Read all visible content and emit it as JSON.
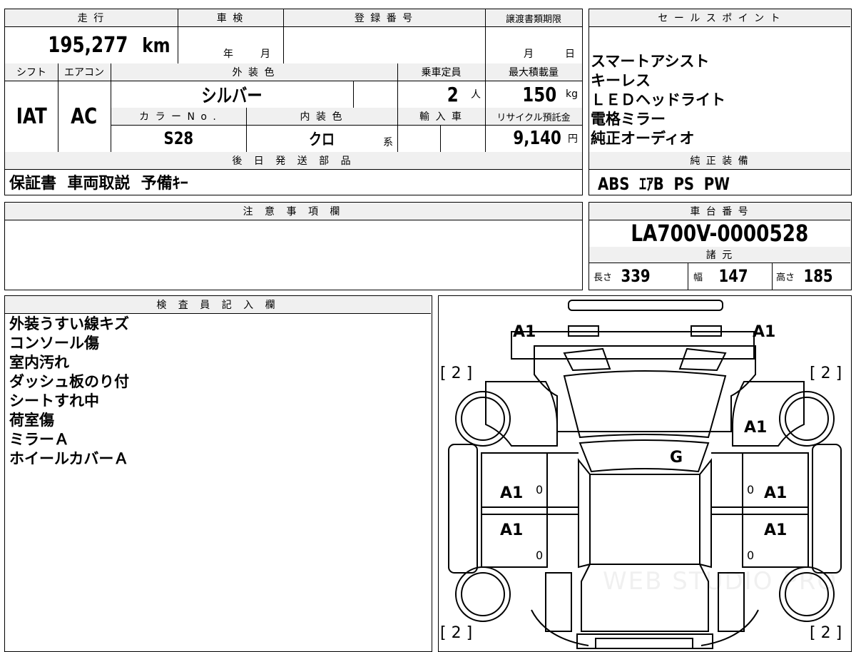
{
  "spec": {
    "mileage_header": "走 行",
    "inspection_header": "車 検",
    "registration_header": "登 録 番 号",
    "transfer_deadline_header": "譲渡書類期限",
    "mileage_value": "195,277",
    "mileage_unit": "km",
    "inspection_year_unit": "年",
    "inspection_month_unit": "月",
    "transfer_month_unit": "月",
    "transfer_day_unit": "日",
    "shift_header": "シフト",
    "aircon_header": "エアコン",
    "exterior_color_header": "外 装 色",
    "capacity_header": "乗車定員",
    "max_load_header": "最大積載量",
    "shift_value": "IAT",
    "aircon_value": "AC",
    "exterior_color_value": "シルバー",
    "capacity_value": "2",
    "capacity_unit": "人",
    "max_load_value": "150",
    "max_load_unit": "kg",
    "color_no_header": "カ ラ ー N o .",
    "interior_color_header": "内 装 色",
    "import_header": "輸 入 車",
    "recycle_header": "リサイクル預託金",
    "color_no_value": "S28",
    "interior_color_value": "クロ",
    "interior_color_unit": "系",
    "recycle_value": "9,140",
    "recycle_unit": "円",
    "later_parts_header": "後 日 発 送 部 品",
    "later_parts_value": "保証書  車両取説  予備ｷｰ"
  },
  "sales_points": {
    "header": "セ ー ル ス ポ イ ン ト",
    "items": [
      "スマートアシスト",
      "キーレス",
      "ＬＥＤヘッドライト",
      "電格ミラー",
      "純正オーディオ"
    ]
  },
  "equipment": {
    "header": "純 正 装 備",
    "value": "ABS  ｴｱB  PS  PW"
  },
  "caution": {
    "header": "注 意 事 項 欄",
    "value": ""
  },
  "chassis": {
    "header": "車 台 番 号",
    "value": "LA700V-0000528",
    "dims_header": "諸 元",
    "length_label": "長さ",
    "length_value": "339",
    "width_label": "幅",
    "width_value": "147",
    "height_label": "高さ",
    "height_value": "185"
  },
  "inspector": {
    "header": "検 査 員 記 入 欄",
    "lines": [
      "外装うすい線キズ",
      "コンソール傷",
      "室内汚れ",
      "ダッシュ板のり付",
      "シートすれ中",
      "荷室傷",
      "ミラーＡ",
      "ホイールカバーＡ"
    ]
  },
  "damage_map": {
    "front_left": "A1",
    "front_right": "A1",
    "fender_right": "A1",
    "windshield": "G",
    "door_front_left": "A1",
    "door_front_right": "A1",
    "door_rear_left": "A1",
    "door_rear_right": "A1",
    "bracket_tl": "[ 2 ]",
    "bracket_tr": "[ 2 ]",
    "bracket_bl": "[ 2 ]",
    "bracket_br": "[ 2 ]",
    "zero_1": "0",
    "zero_2": "0",
    "zero_3": "0",
    "zero_4": "0",
    "watermark": "WEB STUDIO PRO"
  }
}
